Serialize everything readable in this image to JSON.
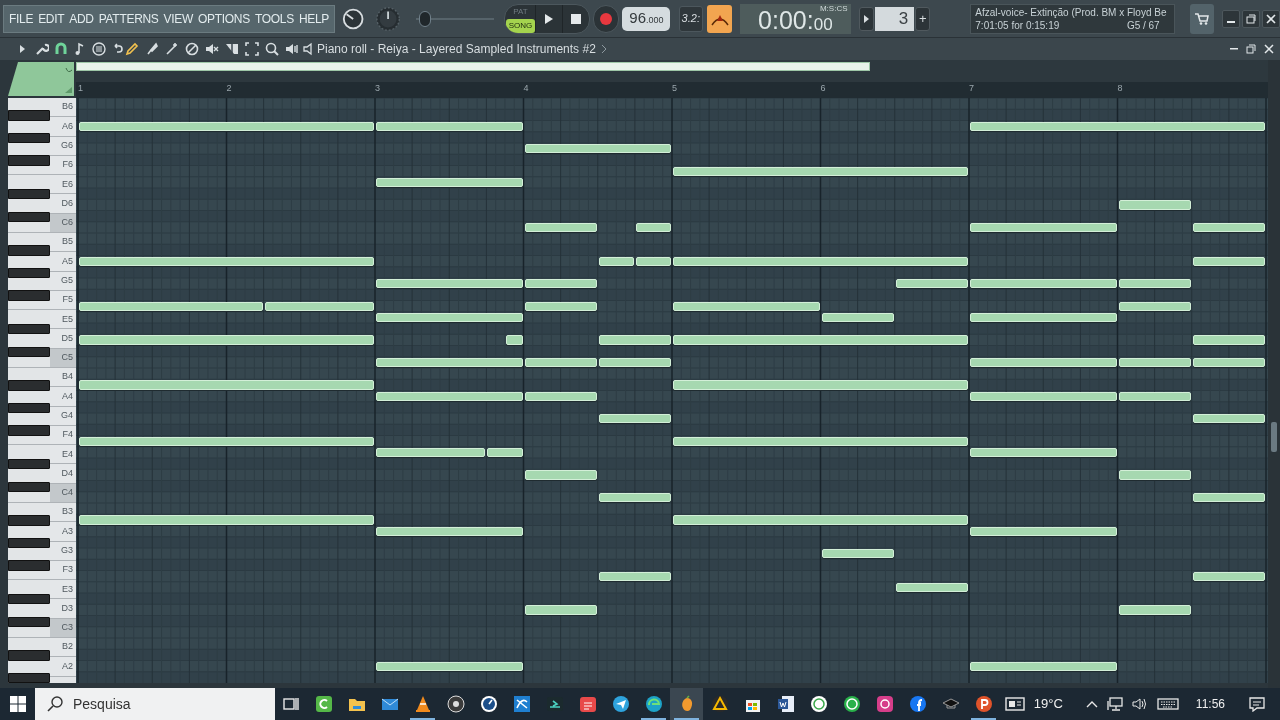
{
  "menu": [
    "FILE",
    "EDIT",
    "ADD",
    "PATTERNS",
    "VIEW",
    "OPTIONS",
    "TOOLS",
    "HELP"
  ],
  "mode_toggle": [
    {
      "label": "PAT",
      "selected": false
    },
    {
      "label": "SONG",
      "selected": true
    }
  ],
  "volume": {
    "level": 0.05
  },
  "tempo": {
    "whole": "96",
    "fraction": ".000"
  },
  "snap_label": "3.2:",
  "time": {
    "main": "0:00:",
    "sub": "00",
    "format": "M:S:CS"
  },
  "pattern": {
    "value": "3",
    "add": "+"
  },
  "hint": {
    "line1": "Afzal-voice- Extinção (Prod. BM x Floyd Be",
    "line2": "7:01:05 for 0:15:19",
    "note": "G5 / 67"
  },
  "toolbar": {
    "snap_on": true,
    "tools": [
      {
        "selected": true
      },
      {
        "selected": false
      },
      {
        "selected": false
      },
      {
        "selected": false
      },
      {
        "selected": false
      },
      {
        "selected": false
      },
      {
        "selected": false
      },
      {
        "selected": false
      },
      {
        "selected": false
      }
    ],
    "title": "Piano roll - Reiya - Layered Sampled Instruments #2"
  },
  "ruler": [
    "1",
    "2",
    "3",
    "4",
    "5",
    "6",
    "7",
    "8"
  ],
  "keys": [
    {
      "label": "B6",
      "shaded": false
    },
    {
      "label": "A6",
      "shaded": false
    },
    {
      "label": "G6",
      "shaded": false
    },
    {
      "label": "F6",
      "shaded": false
    },
    {
      "label": "E6",
      "shaded": false
    },
    {
      "label": "D6",
      "shaded": false
    },
    {
      "label": "C6",
      "shaded": true
    },
    {
      "label": "B5",
      "shaded": false
    },
    {
      "label": "A5",
      "shaded": false
    },
    {
      "label": "G5",
      "shaded": false
    },
    {
      "label": "F5",
      "shaded": false
    },
    {
      "label": "E5",
      "shaded": false
    },
    {
      "label": "D5",
      "shaded": false
    },
    {
      "label": "C5",
      "shaded": true
    },
    {
      "label": "B4",
      "shaded": false
    },
    {
      "label": "A4",
      "shaded": false
    },
    {
      "label": "G4",
      "shaded": false
    },
    {
      "label": "F4",
      "shaded": false
    },
    {
      "label": "E4",
      "shaded": false
    },
    {
      "label": "D4",
      "shaded": false
    },
    {
      "label": "C4",
      "shaded": true
    },
    {
      "label": "B3",
      "shaded": false
    },
    {
      "label": "A3",
      "shaded": false
    },
    {
      "label": "G3",
      "shaded": false
    },
    {
      "label": "F3",
      "shaded": false
    },
    {
      "label": "E3",
      "shaded": false
    },
    {
      "label": "D3",
      "shaded": false
    },
    {
      "label": "C3",
      "shaded": true
    },
    {
      "label": "B2",
      "shaded": false
    },
    {
      "label": "A2",
      "shaded": false
    }
  ],
  "taskbar": {
    "search": {
      "placeholder": "Pesquisa"
    },
    "apps": [
      {
        "running": false,
        "active": false
      },
      {
        "running": false,
        "active": false
      },
      {
        "running": false,
        "active": false
      },
      {
        "running": true,
        "active": false
      },
      {
        "running": false,
        "active": false
      },
      {
        "running": false,
        "active": false
      },
      {
        "running": false,
        "active": false
      },
      {
        "running": false,
        "active": false
      },
      {
        "running": false,
        "active": false
      },
      {
        "running": false,
        "active": false
      },
      {
        "running": true,
        "active": false
      },
      {
        "running": true,
        "active": true
      },
      {
        "running": false,
        "active": false
      },
      {
        "running": false,
        "active": false
      },
      {
        "running": false,
        "active": false
      },
      {
        "running": false,
        "active": false
      },
      {
        "running": false,
        "active": false
      },
      {
        "running": false,
        "active": false
      },
      {
        "running": false,
        "active": false
      },
      {
        "running": false,
        "active": false
      },
      {
        "running": true,
        "active": false
      }
    ],
    "weather": "19°C",
    "clock": "11:56"
  }
}
